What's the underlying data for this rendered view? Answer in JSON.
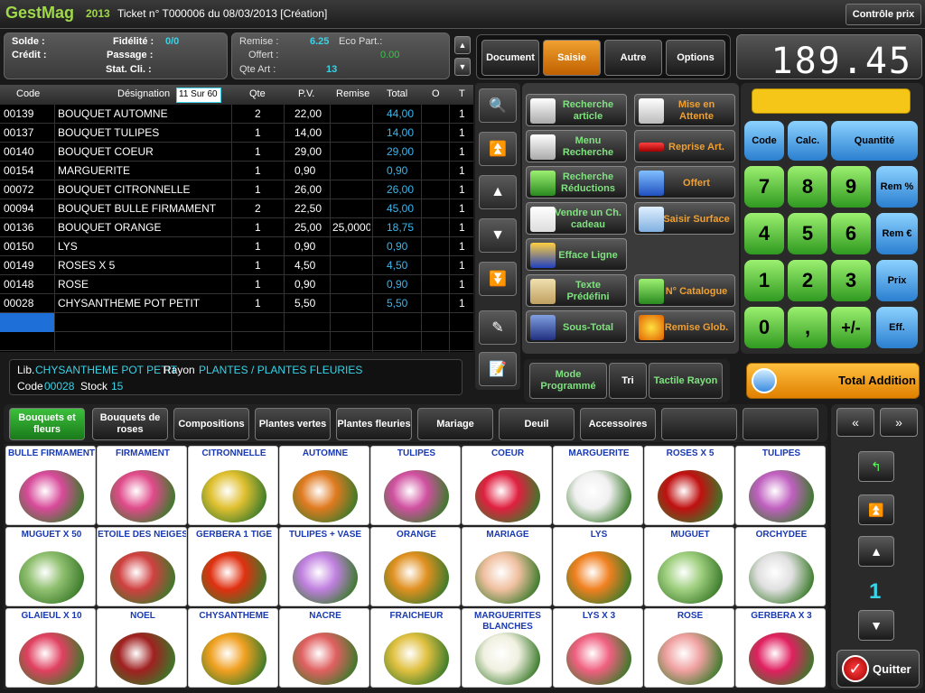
{
  "header": {
    "logo": "GestMag",
    "year": "2013",
    "ticket": "Ticket n° T000006 du 08/03/2013   [Création]",
    "control_button": "Contrôle prix"
  },
  "info_left": {
    "solde_label": "Solde :",
    "credit_label": "Crédit :",
    "fidelite_label": "Fidélité :",
    "fidelite_value": "0/0",
    "passage_label": "Passage :",
    "stat_label": "Stat. Cli. :"
  },
  "info_mid": {
    "remise_label": "Remise :",
    "remise_value": "6.25",
    "eco_label": "Eco Part.:",
    "offert_label": "Offert :",
    "offert_value": "0.00",
    "qte_label": "Qte Art :",
    "qte_value": "13"
  },
  "menu": {
    "items": [
      "Document",
      "Saisie",
      "Autre",
      "Options"
    ],
    "active": "Saisie"
  },
  "total_display": "189.45",
  "table": {
    "headers": [
      "Code",
      "Désignation",
      "Qte",
      "P.V.",
      "Remise",
      "Total",
      "O",
      "T"
    ],
    "page_indicator": "11 Sur 60",
    "rows": [
      {
        "code": "00139",
        "designation": "BOUQUET AUTOMNE",
        "qte": "2",
        "pv": "22,00",
        "remise": "",
        "total": "44,00",
        "t": "1"
      },
      {
        "code": "00137",
        "designation": "BOUQUET TULIPES",
        "qte": "1",
        "pv": "14,00",
        "remise": "",
        "total": "14,00",
        "t": "1"
      },
      {
        "code": "00140",
        "designation": "BOUQUET COEUR",
        "qte": "1",
        "pv": "29,00",
        "remise": "",
        "total": "29,00",
        "t": "1"
      },
      {
        "code": "00154",
        "designation": "MARGUERITE",
        "qte": "1",
        "pv": "0,90",
        "remise": "",
        "total": "0,90",
        "t": "1"
      },
      {
        "code": "00072",
        "designation": "BOUQUET CITRONNELLE",
        "qte": "1",
        "pv": "26,00",
        "remise": "",
        "total": "26,00",
        "t": "1"
      },
      {
        "code": "00094",
        "designation": "BOUQUET BULLE FIRMAMENT",
        "qte": "2",
        "pv": "22,50",
        "remise": "",
        "total": "45,00",
        "t": "1"
      },
      {
        "code": "00136",
        "designation": "BOUQUET ORANGE",
        "qte": "1",
        "pv": "25,00",
        "remise": "25,0000",
        "total": "18,75",
        "t": "1"
      },
      {
        "code": "00150",
        "designation": "LYS",
        "qte": "1",
        "pv": "0,90",
        "remise": "",
        "total": "0,90",
        "t": "1"
      },
      {
        "code": "00149",
        "designation": "ROSES X 5",
        "qte": "1",
        "pv": "4,50",
        "remise": "",
        "total": "4,50",
        "t": "1"
      },
      {
        "code": "00148",
        "designation": "ROSE",
        "qte": "1",
        "pv": "0,90",
        "remise": "",
        "total": "0,90",
        "t": "1"
      },
      {
        "code": "00028",
        "designation": "CHYSANTHEME POT PETIT",
        "qte": "1",
        "pv": "5,50",
        "remise": "",
        "total": "5,50",
        "t": "1"
      }
    ]
  },
  "lib_panel": {
    "lib_label": "Lib.",
    "lib_value": "CHYSANTHEME POT PETIT",
    "rayon_label": "Rayon",
    "rayon_value": "PLANTES / PLANTES FLEURIES",
    "code_label": "Code",
    "code_value": "00028",
    "stock_label": "Stock",
    "stock_value": "15"
  },
  "functions": {
    "left": [
      "Recherche article",
      "Menu Recherche",
      "Recherche Réductions",
      "Vendre un Ch. cadeau",
      "Efface Ligne",
      "Texte Prédéfini",
      "Sous-Total"
    ],
    "right": [
      "Mise en Attente",
      "Reprise Art.",
      "Offert",
      "Saisir Surface",
      "N° Catalogue",
      "Remise Glob."
    ],
    "bottom": [
      "Mode Programmé",
      "Tri",
      "Tactile Rayon"
    ]
  },
  "keypad": {
    "top": [
      "Code",
      "Calc.",
      "Quantité"
    ],
    "digits": [
      "7",
      "8",
      "9",
      "4",
      "5",
      "6",
      "1",
      "2",
      "3",
      "0",
      ",",
      "+/-"
    ],
    "side": [
      "Rem %",
      "Rem €",
      "Prix",
      "Eff."
    ],
    "total_button": "Total Addition"
  },
  "categories": [
    "Bouquets et fleurs",
    "Bouquets de roses",
    "Compositions",
    "Plantes vertes",
    "Plantes fleuries",
    "Mariage",
    "Deuil",
    "Accessoires",
    "",
    ""
  ],
  "products": [
    {
      "name": "BULLE FIRMAMENT",
      "color": "#d84a9a"
    },
    {
      "name": "FIRMAMENT",
      "color": "#e04a8a"
    },
    {
      "name": "CITRONNELLE",
      "color": "#e0c030"
    },
    {
      "name": "AUTOMNE",
      "color": "#e07a20"
    },
    {
      "name": "TULIPES",
      "color": "#d050a0"
    },
    {
      "name": "COEUR",
      "color": "#e02040"
    },
    {
      "name": "MARGUERITE",
      "color": "#f0f0f0"
    },
    {
      "name": "ROSES X 5",
      "color": "#c01010"
    },
    {
      "name": "TULIPES",
      "color": "#c060c0"
    },
    {
      "name": "MUGUET X 50",
      "color": "#90c070"
    },
    {
      "name": "ETOILE DES NEIGES",
      "color": "#d04040"
    },
    {
      "name": "GERBERA 1 TIGE",
      "color": "#e03010"
    },
    {
      "name": "TULIPES + VASE",
      "color": "#c080e0"
    },
    {
      "name": "ORANGE",
      "color": "#e09020"
    },
    {
      "name": "MARIAGE",
      "color": "#f0c0a0"
    },
    {
      "name": "LYS",
      "color": "#f08020"
    },
    {
      "name": "MUGUET",
      "color": "#a0d080"
    },
    {
      "name": "ORCHYDEE",
      "color": "#e0e0e0"
    },
    {
      "name": "GLAIEUL X 10",
      "color": "#e04060"
    },
    {
      "name": "NOEL",
      "color": "#a02020"
    },
    {
      "name": "CHYSANTHEME",
      "color": "#f0a020"
    },
    {
      "name": "NACRE",
      "color": "#e06060"
    },
    {
      "name": "FRAICHEUR",
      "color": "#e0c040"
    },
    {
      "name": "MARGUERITES BLANCHES",
      "color": "#f0f0e0"
    },
    {
      "name": "LYS X 3",
      "color": "#f06080"
    },
    {
      "name": "ROSE",
      "color": "#f0a0a0"
    },
    {
      "name": "GERBERA X 3",
      "color": "#e02060"
    }
  ],
  "right_nav": {
    "page": "1",
    "quit": "Quitter"
  }
}
